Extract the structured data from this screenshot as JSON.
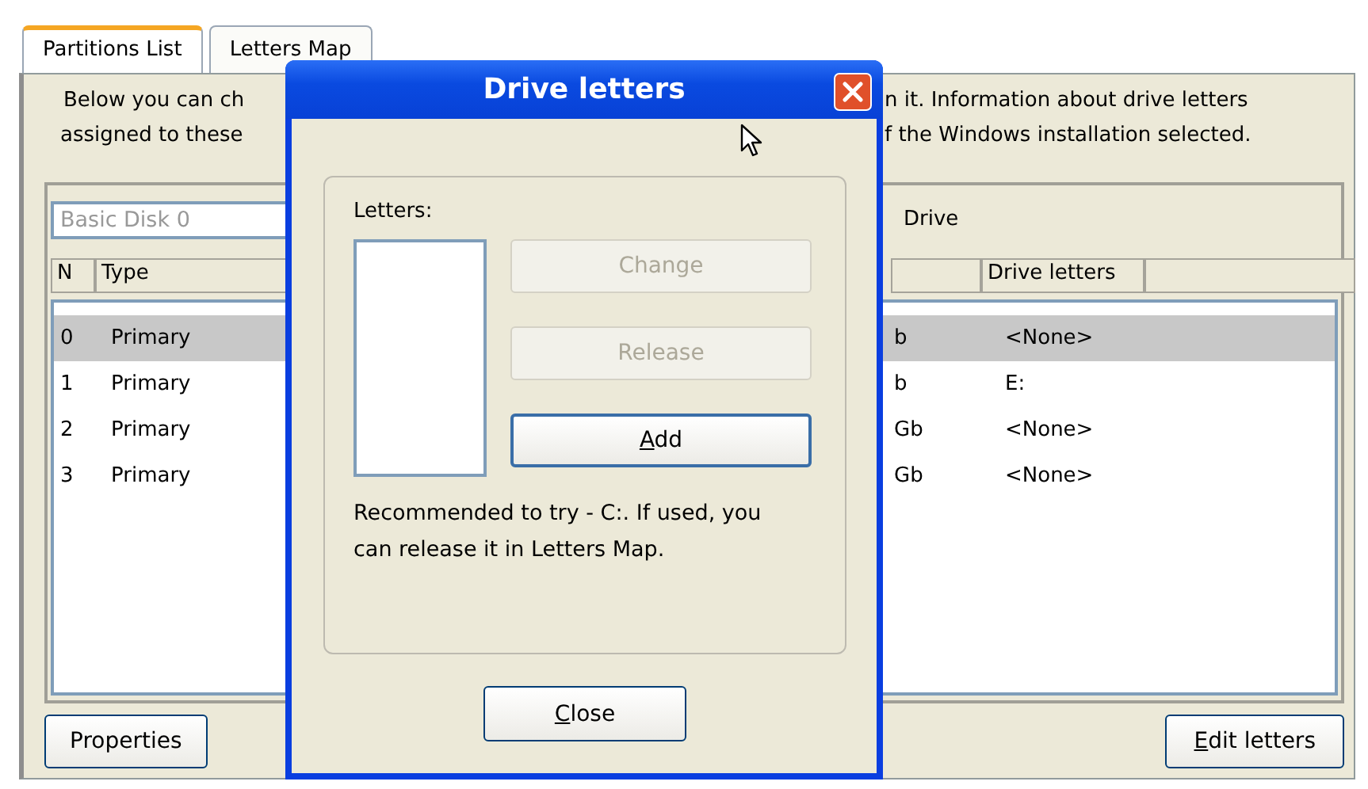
{
  "tabs": [
    {
      "label": "Partitions List",
      "selected": true
    },
    {
      "label": "Letters Map",
      "selected": false
    }
  ],
  "description": {
    "left_lines": [
      "Below you can ch",
      "assigned to these"
    ],
    "right_lines": [
      "n it. Information about drive letters",
      "f the Windows installation selected."
    ]
  },
  "disk_field": {
    "value": "Basic Disk 0"
  },
  "drive_label": "Drive",
  "table": {
    "columns_left": [
      "N",
      "Type"
    ],
    "columns_right": [
      "Drive letters"
    ],
    "rows": [
      {
        "n": "0",
        "type": "Primary",
        "size": "b",
        "letters": "<None>",
        "selected": true
      },
      {
        "n": "1",
        "type": "Primary",
        "size": "b",
        "letters": "E:",
        "selected": false
      },
      {
        "n": "2",
        "type": "Primary",
        "size": "Gb",
        "letters": "<None>",
        "selected": false
      },
      {
        "n": "3",
        "type": "Primary",
        "size": "Gb",
        "letters": "<None>",
        "selected": false
      }
    ]
  },
  "buttons": [
    {
      "label": "Properties",
      "access_key": false
    },
    {
      "label": "Edit letters",
      "access_key": true
    }
  ],
  "dialog": {
    "title": "Drive letters",
    "group_label": "Letters:",
    "actions": [
      {
        "label": "Change",
        "disabled": true,
        "access_key": false,
        "default": false
      },
      {
        "label": "Release",
        "disabled": true,
        "access_key": false,
        "default": false
      },
      {
        "label": "Add",
        "disabled": false,
        "access_key": true,
        "default": true
      }
    ],
    "note": "Recommended to try - C:. If used, you can release it in Letters Map.",
    "close": {
      "label": "Close",
      "access_key": true
    }
  }
}
